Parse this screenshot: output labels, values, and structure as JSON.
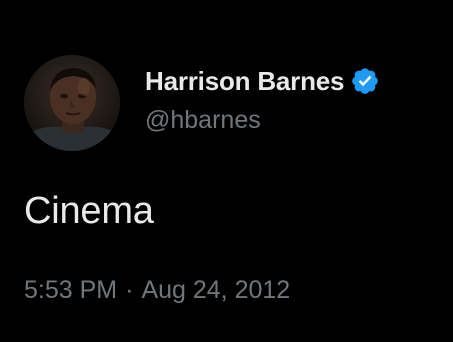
{
  "author": {
    "display_name": "Harrison Barnes",
    "handle": "@hbarnes",
    "verified": true,
    "avatar_icon": "profile-photo-avatar",
    "verified_icon": "verified-badge-icon",
    "verified_color": "#1d9bf0"
  },
  "tweet": {
    "text": "Cinema",
    "time": "5:53 PM",
    "separator": "·",
    "date": "Aug 24, 2012"
  },
  "colors": {
    "background": "#000000",
    "primary_text": "#e7e9ea",
    "secondary_text": "#71767b"
  }
}
